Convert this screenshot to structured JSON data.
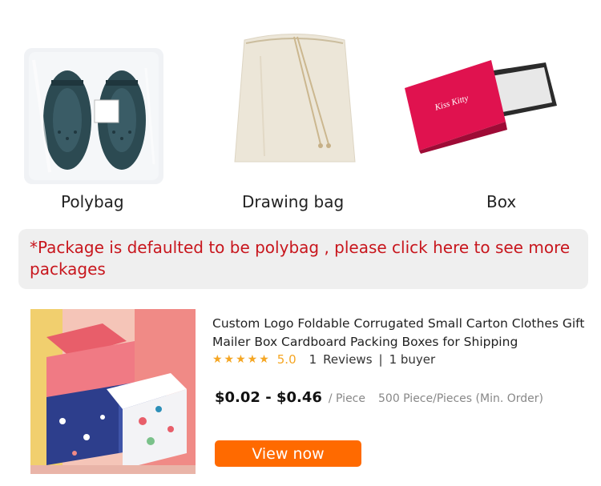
{
  "packages": [
    {
      "label": "Polybag",
      "icon": "polybag-shoes-image"
    },
    {
      "label": "Drawing bag",
      "icon": "drawstring-bag-image"
    },
    {
      "label": "Box",
      "icon": "gift-box-image"
    }
  ],
  "box_brand_text": "Kiss Kitty",
  "notice": {
    "text": "*Package is defaulted to be polybag , please click here to see more packages"
  },
  "product": {
    "title": "Custom Logo Foldable Corrugated Small Carton Clothes Gift Mailer Box Cardboard Packing Boxes for Shipping",
    "stars": "★★★★★",
    "score": "5.0",
    "reviews_count": "1",
    "reviews_label": "Reviews",
    "separator": "|",
    "buyers": "1 buyer",
    "price": "$0.02 - $0.46",
    "unit": "/ Piece",
    "moq": "500 Piece/Pieces (Min. Order)",
    "cta": "View now"
  },
  "colors": {
    "accent": "#ff6a00",
    "notice_text": "#c8161d",
    "star": "#f5a623"
  }
}
